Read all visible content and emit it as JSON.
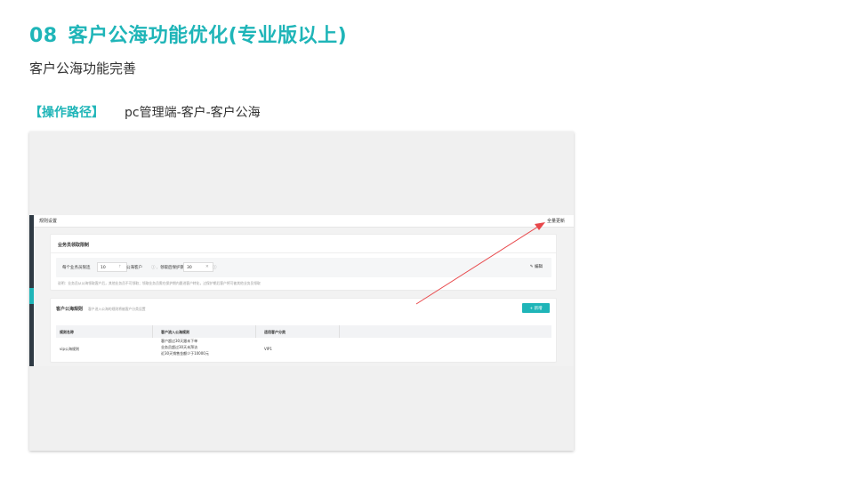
{
  "slide": {
    "number": "08",
    "title": "客户公海功能优化(专业版以上)",
    "subtitle": "客户公海功能完善",
    "path_label": "【操作路径】",
    "path_value": "pc管理端-客户-客户公海"
  },
  "screenshot": {
    "topbar": {
      "title": "规则设置",
      "link": "全量更新"
    },
    "card1": {
      "title": "业务员领取限制",
      "form": {
        "label_each": "每个业务员限连",
        "input1_value": "10",
        "label_pool": "公海客户",
        "label_protect": "领取后保护期",
        "input2_value": "30",
        "edit_label": "编辑"
      },
      "note": "说明：业务员从公海领取客户后，其他业务员不可领取；领取业务员需在保护期内跟进客户转化，过保护期后客户将可被其他业务员领取"
    },
    "card2": {
      "title": "客户公海规则",
      "subtitle": "客户进入公海的规则将被客户分类设置",
      "add_button": "+ 新增",
      "columns": [
        "规则名称",
        "客户流入公海规则",
        "适用客户分类"
      ],
      "rows": [
        {
          "name": "vip公海规则",
          "rules": [
            "客户超过30天跟未下单",
            "业务员超过30天未拜访",
            "近30天销售金额少于10000元"
          ],
          "category": "VIP1"
        }
      ]
    }
  },
  "colors": {
    "accent": "#1fb5b8",
    "arrow": "#e8474a",
    "sidebar": "#2f3a44"
  }
}
